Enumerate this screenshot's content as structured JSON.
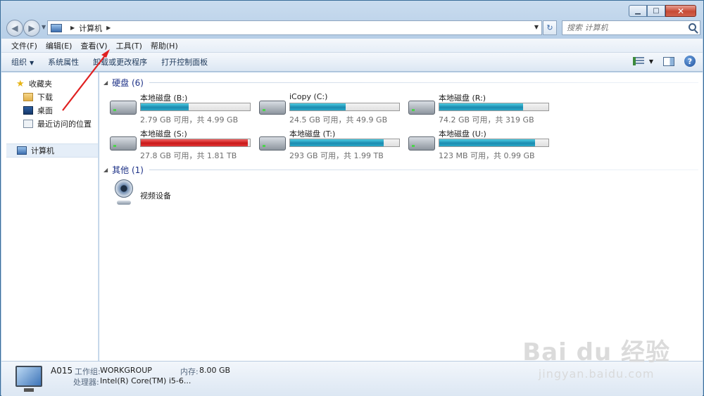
{
  "window": {
    "minimize_glyph": "▁",
    "maximize_glyph": "□",
    "close_glyph": "✕"
  },
  "address": {
    "path": "计算机",
    "back_glyph": "◀",
    "forward_glyph": "▶",
    "refresh_glyph": "↻"
  },
  "search": {
    "placeholder": "搜索 计算机"
  },
  "menu": [
    "文件(F)",
    "编辑(E)",
    "查看(V)",
    "工具(T)",
    "帮助(H)"
  ],
  "commands": {
    "organize": "组织",
    "system_properties": "系统属性",
    "uninstall": "卸载或更改程序",
    "control_panel": "打开控制面板"
  },
  "nav": {
    "favorites": "收藏夹",
    "downloads": "下载",
    "desktop": "桌面",
    "recent": "最近访问的位置",
    "computer": "计算机"
  },
  "groups": {
    "hard_disks": "硬盘 (6)",
    "other": "其他 (1)"
  },
  "drives": [
    {
      "name": "本地磁盘 (B:)",
      "stat": "2.79 GB 可用，共 4.99 GB",
      "used_fraction": 0.44,
      "full": false
    },
    {
      "name": "iCopy (C:)",
      "stat": "24.5 GB 可用，共 49.9 GB",
      "used_fraction": 0.51,
      "full": false
    },
    {
      "name": "本地磁盘 (R:)",
      "stat": "74.2 GB 可用，共 319 GB",
      "used_fraction": 0.77,
      "full": false
    },
    {
      "name": "本地磁盘 (S:)",
      "stat": "27.8 GB 可用，共 1.81 TB",
      "used_fraction": 0.98,
      "full": true
    },
    {
      "name": "本地磁盘 (T:)",
      "stat": "293 GB 可用，共 1.99 TB",
      "used_fraction": 0.86,
      "full": false
    },
    {
      "name": "本地磁盘 (U:)",
      "stat": "123 MB 可用，共 0.99 GB",
      "used_fraction": 0.88,
      "full": false
    }
  ],
  "devices": {
    "webcam": "视频设备"
  },
  "details": {
    "name": "A015",
    "workgroup_label": "工作组:",
    "workgroup": "WORKGROUP",
    "memory_label": "内存:",
    "memory": "8.00 GB",
    "processor_label": "处理器:",
    "processor": "Intel(R) Core(TM) i5-6..."
  },
  "watermark": {
    "logo": "Bai du 经验",
    "url": "jingyan.baidu.com"
  },
  "colors": {
    "annotation_arrow": "#e02020",
    "usage_bar": "#26a0c8",
    "usage_bar_full": "#d41c1c"
  }
}
